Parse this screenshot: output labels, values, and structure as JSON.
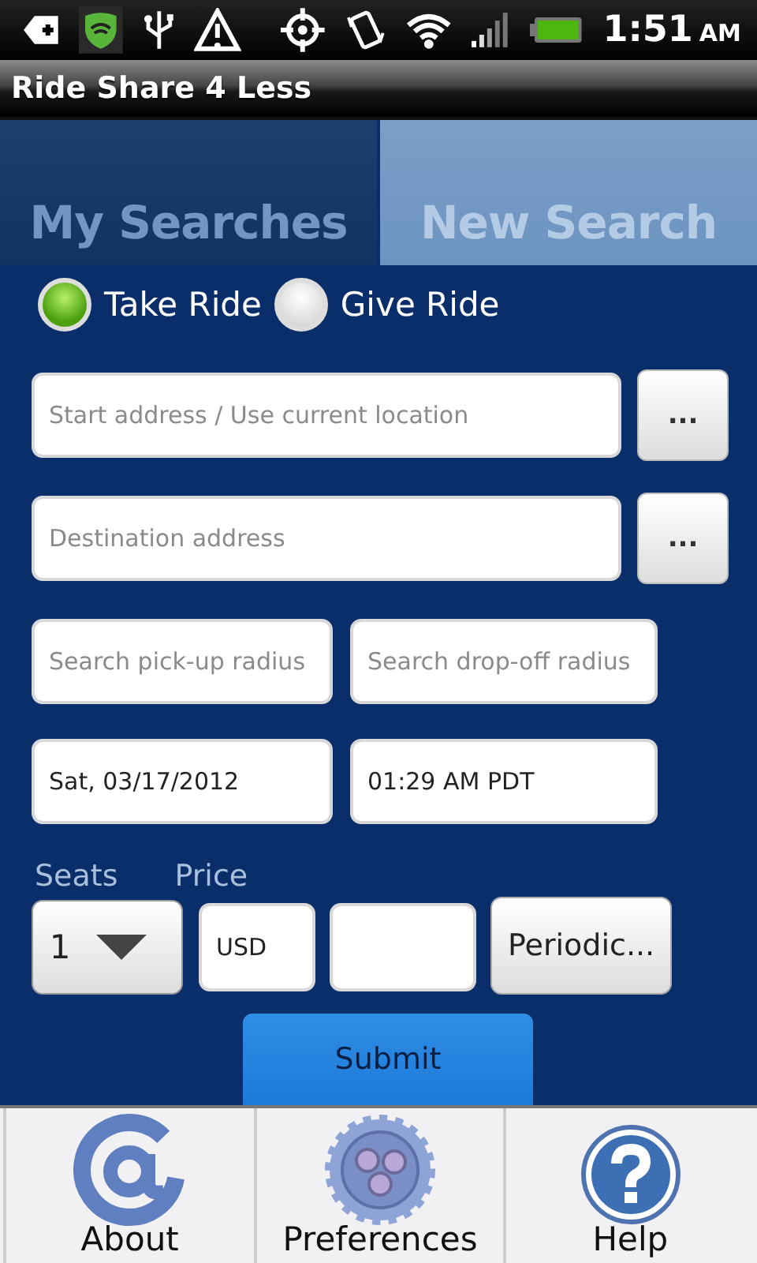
{
  "status_bar": {
    "time": "1:51",
    "meridiem": "AM"
  },
  "title_bar": {
    "title": "Ride Share 4 Less"
  },
  "tabs": [
    {
      "label": "My Searches",
      "selected": false
    },
    {
      "label": "New Search",
      "selected": true
    }
  ],
  "ride_type": [
    {
      "label": "Take Ride",
      "selected": true
    },
    {
      "label": "Give Ride",
      "selected": false
    }
  ],
  "address_rows": [
    {
      "placeholder": "Start address / Use current location",
      "button": "..."
    },
    {
      "placeholder": "Destination address",
      "button": "..."
    }
  ],
  "radius_fields": [
    {
      "placeholder": "Search pick-up radius"
    },
    {
      "placeholder": "Search drop-off radius"
    }
  ],
  "when_fields": [
    {
      "value": "Sat, 03/17/2012"
    },
    {
      "value": "01:29 AM PDT"
    }
  ],
  "seats": {
    "label": "Seats",
    "value": "1"
  },
  "price": {
    "label": "Price",
    "currency": "USD"
  },
  "periodic_button": "Periodic...",
  "submit_button": "Submit",
  "bottom_nav": [
    {
      "kind": "about",
      "label": "About"
    },
    {
      "kind": "preferences",
      "label": "Preferences"
    },
    {
      "kind": "help",
      "label": "Help"
    }
  ]
}
